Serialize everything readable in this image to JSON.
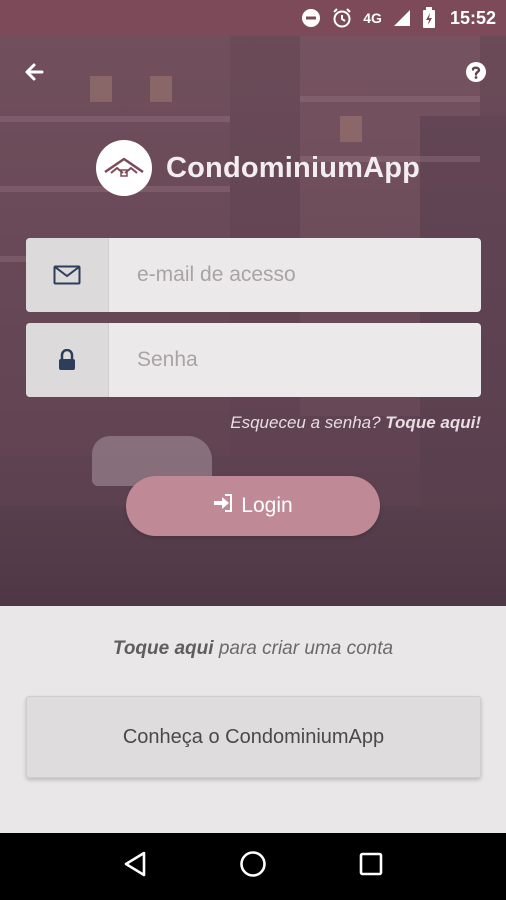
{
  "status_bar": {
    "network": "4G",
    "time": "15:52",
    "icons": [
      "do-not-disturb-icon",
      "alarm-icon",
      "signal-icon",
      "battery-icon"
    ]
  },
  "header": {
    "back_icon": "arrow-left-icon",
    "help_icon": "question-circle-icon"
  },
  "brand": {
    "name": "CondominiumApp",
    "logo_icon": "house-roof-logo"
  },
  "login_form": {
    "email_placeholder": "e-mail de acesso",
    "email_value": "",
    "password_placeholder": "Senha",
    "password_value": "",
    "email_icon": "envelope-icon",
    "password_icon": "lock-icon",
    "forgot_text": "Esqueceu a senha?",
    "forgot_link": "Toque aqui!",
    "login_label": "Login",
    "login_icon": "sign-in-icon"
  },
  "footer": {
    "create_link": "Toque aqui",
    "create_text": "para criar uma conta",
    "know_button": "Conheça o CondominiumApp"
  },
  "navigation": {
    "icons": [
      "back-triangle-icon",
      "home-circle-icon",
      "recents-square-icon"
    ]
  },
  "colors": {
    "status_bar": "#7d4a59",
    "login_button": "#bf8a96",
    "background": "#e9e7e8",
    "nav_bar": "#000000"
  }
}
